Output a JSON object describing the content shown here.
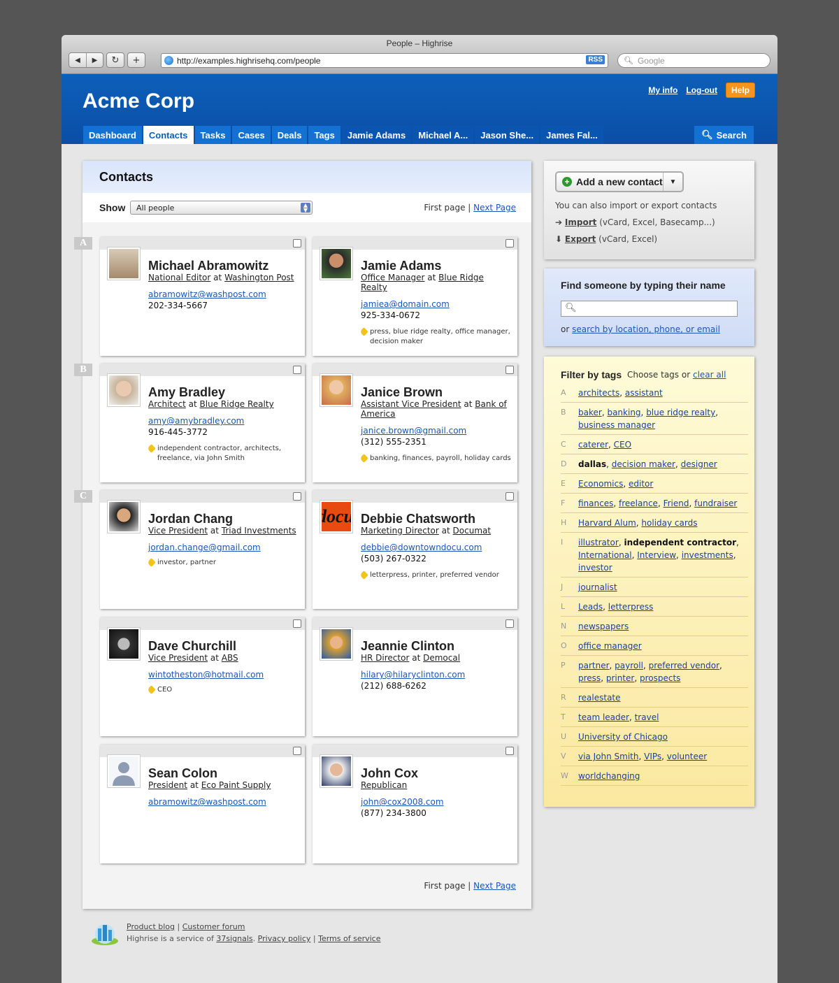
{
  "window": {
    "title": "People – Highrise",
    "url": "http://examples.highrisehq.com/people",
    "rss": "RSS",
    "search_placeholder": "Google"
  },
  "header": {
    "brand": "Acme Corp",
    "links": {
      "my_info": "My info",
      "logout": "Log-out",
      "help": "Help"
    },
    "tabs": [
      "Dashboard",
      "Contacts",
      "Tasks",
      "Cases",
      "Deals",
      "Tags",
      "Jamie Adams",
      "Michael A...",
      "Jason She...",
      "James Fal..."
    ],
    "search": "Search"
  },
  "main": {
    "title": "Contacts",
    "show_label": "Show",
    "show_value": "All people",
    "pager": {
      "first": "First page",
      "sep": "|",
      "next": "Next Page"
    },
    "letters": [
      "A",
      "B",
      "C"
    ],
    "contacts": [
      {
        "name": "Michael Abramowitz",
        "title": "National Editor",
        "at": "at",
        "company": "Washington Post",
        "email": "abramowitz@washpost.com",
        "phone": "202-334-5667",
        "tags": ""
      },
      {
        "name": "Jamie Adams",
        "title": "Office Manager",
        "at": "at",
        "company": "Blue Ridge Realty",
        "email": "jamiea@domain.com",
        "phone": "925-334-0672",
        "tags": "press, blue ridge realty, office manager, decision maker"
      },
      {
        "name": "Amy Bradley",
        "title": "Architect",
        "at": "at",
        "company": "Blue Ridge Realty",
        "email": "amy@amybradley.com",
        "phone": "916-445-3772",
        "tags": "independent contractor, architects, freelance, via John Smith"
      },
      {
        "name": "Janice Brown",
        "title": "Assistant Vice President",
        "at": "at",
        "company": "Bank of America",
        "email": "janice.brown@gmail.com",
        "phone": "(312) 555-2351",
        "tags": "banking, finances, payroll, holiday cards"
      },
      {
        "name": "Jordan Chang",
        "title": "Vice President",
        "at": "at",
        "company": "Triad Investments",
        "email": "jordan.change@gmail.com",
        "phone": "",
        "tags": "investor, partner"
      },
      {
        "name": "Debbie Chatsworth",
        "title": "Marketing Director",
        "at": "at",
        "company": "Documat",
        "email": "debbie@downtowndocu.com",
        "phone": "(503) 267-0322",
        "tags": "letterpress, printer, preferred vendor"
      },
      {
        "name": "Dave Churchill",
        "title": "Vice President",
        "at": "at",
        "company": "ABS",
        "email": "wintotheston@hotmail.com",
        "phone": "",
        "tags": "CEO"
      },
      {
        "name": "Jeannie Clinton",
        "title": "HR Director",
        "at": "at",
        "company": "Democal",
        "email": "hilary@hilaryclinton.com",
        "phone": "(212) 688-6262",
        "tags": ""
      },
      {
        "name": "Sean Colon",
        "title": "President",
        "at": "at",
        "company": "Eco Paint Supply",
        "email": "abramowitz@washpost.com",
        "phone": "",
        "tags": ""
      },
      {
        "name": "John Cox",
        "title": "Republican",
        "at": "",
        "company": "",
        "email": "john@cox2008.com",
        "phone": "(877) 234-3800",
        "tags": ""
      }
    ],
    "photo_logo_text": "docu"
  },
  "sidebar": {
    "add_contact": "Add a new contact",
    "import_export_note": "You can also import or export contacts",
    "import_label": "Import",
    "import_note": "(vCard, Excel, Basecamp...)",
    "export_label": "Export",
    "export_note": "(vCard, Excel)",
    "find_title": "Find someone by typing their name",
    "find_or": "or",
    "find_alt_link": "search by location, phone, or email",
    "filter_title": "Filter by tags",
    "filter_choose": "Choose tags or",
    "filter_clear": "clear all",
    "tag_groups": [
      {
        "letter": "A",
        "tags": [
          "architects",
          "assistant"
        ]
      },
      {
        "letter": "B",
        "tags": [
          "baker",
          "banking",
          "blue ridge realty",
          "business manager"
        ]
      },
      {
        "letter": "C",
        "tags": [
          "caterer",
          "CEO"
        ]
      },
      {
        "letter": "D",
        "tags": [
          "dallas",
          "decision maker",
          "designer"
        ],
        "bold": [
          "dallas"
        ]
      },
      {
        "letter": "E",
        "tags": [
          "Economics",
          "editor"
        ]
      },
      {
        "letter": "F",
        "tags": [
          "finances",
          "freelance",
          "Friend",
          "fundraiser"
        ]
      },
      {
        "letter": "H",
        "tags": [
          "Harvard Alum",
          "holiday cards"
        ]
      },
      {
        "letter": "I",
        "tags": [
          "illustrator",
          "independent contractor",
          "International",
          "Interview",
          "investments",
          "investor"
        ],
        "bold": [
          "independent contractor"
        ]
      },
      {
        "letter": "J",
        "tags": [
          "journalist"
        ]
      },
      {
        "letter": "L",
        "tags": [
          "Leads",
          "letterpress"
        ]
      },
      {
        "letter": "N",
        "tags": [
          "newspapers"
        ]
      },
      {
        "letter": "O",
        "tags": [
          "office manager"
        ]
      },
      {
        "letter": "P",
        "tags": [
          "partner",
          "payroll",
          "preferred vendor",
          "press",
          "printer",
          "prospects"
        ]
      },
      {
        "letter": "R",
        "tags": [
          "realestate"
        ]
      },
      {
        "letter": "T",
        "tags": [
          "team leader",
          "travel"
        ]
      },
      {
        "letter": "U",
        "tags": [
          "University of Chicago"
        ]
      },
      {
        "letter": "V",
        "tags": [
          "via John Smith",
          "VIPs",
          "volunteer"
        ]
      },
      {
        "letter": "W",
        "tags": [
          "worldchanging"
        ]
      }
    ]
  },
  "footer": {
    "product_blog": "Product blog",
    "sep": "|",
    "customer_forum": "Customer forum",
    "service_prefix": "Highrise is a service of",
    "signals": "37signals",
    "period": ".",
    "privacy": "Privacy policy",
    "terms": "Terms of service"
  },
  "colors": {
    "header_blue": "#0b4ea6",
    "tab_blue": "#1471d4",
    "help_orange": "#f7941d",
    "link_blue": "#1a56b8",
    "tag_panel": "#fbe8a0",
    "find_panel": "#cfdcf6"
  }
}
